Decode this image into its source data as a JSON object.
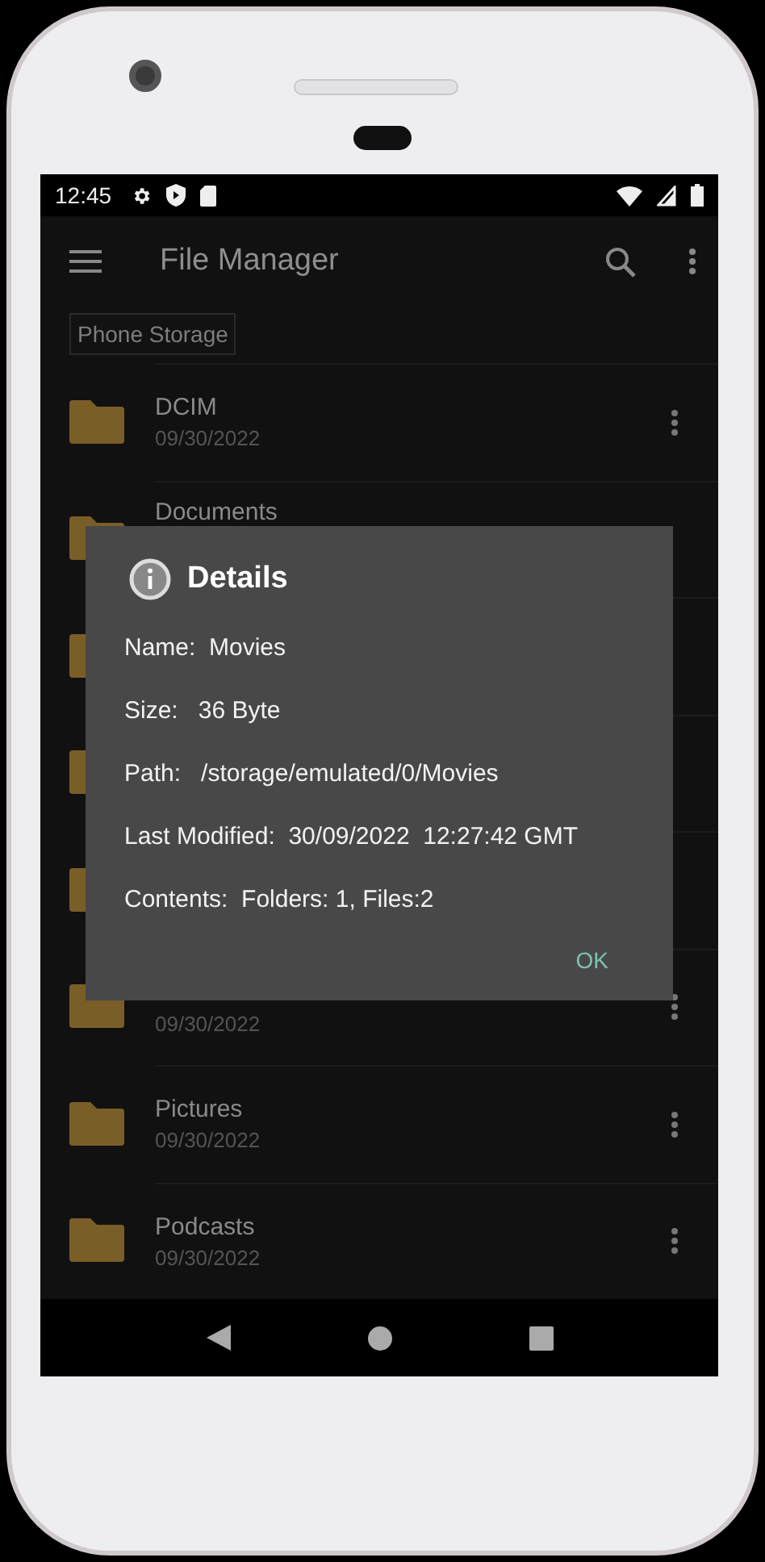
{
  "status_bar": {
    "time": "12:45"
  },
  "app_bar": {
    "title": "File Manager"
  },
  "breadcrumb": "Phone Storage",
  "folders": [
    {
      "kind": "folder",
      "name": "DCIM",
      "date": "09/30/2022"
    },
    {
      "kind": "folder",
      "name": "Documents"
    },
    {
      "kind": "folder"
    },
    {
      "kind": "folder"
    },
    {
      "kind": "folder"
    },
    {
      "kind": "folder",
      "date": "09/30/2022"
    },
    {
      "kind": "folder",
      "name": "Pictures",
      "date": "09/30/2022"
    },
    {
      "kind": "folder",
      "name": "Podcasts",
      "date": "09/30/2022"
    }
  ],
  "dialog": {
    "title": "Details",
    "lines": [
      "Name:  Movies",
      "Size:   36 Byte",
      "Path:   /storage/emulated/0/Movies",
      "Last Modified:  30/09/2022  12:27:42 GMT",
      "Contents:  Folders: 1, Files:2"
    ],
    "button": "OK"
  }
}
